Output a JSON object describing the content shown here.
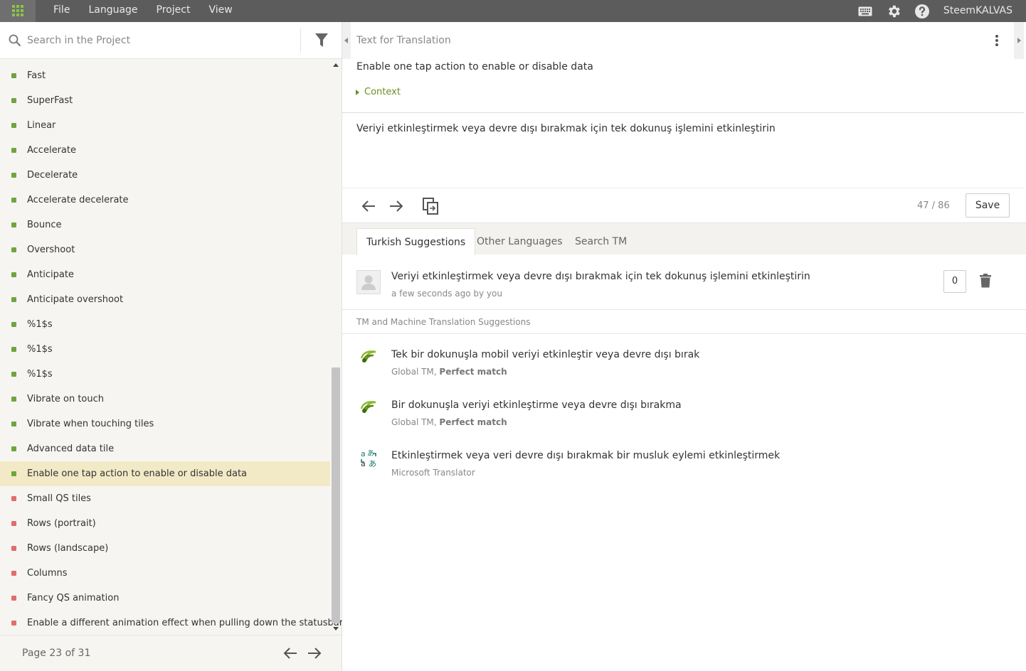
{
  "topbar": {
    "menu": [
      "File",
      "Language",
      "Project",
      "View"
    ],
    "icons": [
      "keyboard-icon",
      "gear-icon",
      "help-icon"
    ],
    "user": "SteemKALVAS"
  },
  "search": {
    "placeholder": "Search in the Project"
  },
  "strings": [
    {
      "label": "Fast",
      "status": "translated"
    },
    {
      "label": "SuperFast",
      "status": "translated"
    },
    {
      "label": "Linear",
      "status": "translated"
    },
    {
      "label": "Accelerate",
      "status": "translated"
    },
    {
      "label": "Decelerate",
      "status": "translated"
    },
    {
      "label": "Accelerate decelerate",
      "status": "translated"
    },
    {
      "label": "Bounce",
      "status": "translated"
    },
    {
      "label": "Overshoot",
      "status": "translated"
    },
    {
      "label": "Anticipate",
      "status": "translated"
    },
    {
      "label": "Anticipate overshoot",
      "status": "translated"
    },
    {
      "label": "%1$s",
      "status": "translated"
    },
    {
      "label": "%1$s",
      "status": "translated"
    },
    {
      "label": "%1$s",
      "status": "translated"
    },
    {
      "label": "Vibrate on touch",
      "status": "translated"
    },
    {
      "label": "Vibrate when touching tiles",
      "status": "translated"
    },
    {
      "label": "Advanced data tile",
      "status": "translated"
    },
    {
      "label": "Enable one tap action to enable or disable data",
      "status": "translated",
      "selected": true
    },
    {
      "label": "Small QS tiles",
      "status": "untranslated"
    },
    {
      "label": "Rows (portrait)",
      "status": "untranslated"
    },
    {
      "label": "Rows (landscape)",
      "status": "untranslated"
    },
    {
      "label": "Columns",
      "status": "untranslated"
    },
    {
      "label": "Fancy QS animation",
      "status": "untranslated"
    },
    {
      "label": "Enable a different animation effect when pulling down the statusbar",
      "status": "untranslated"
    }
  ],
  "pager": {
    "text": "Page 23 of 31"
  },
  "source": {
    "title": "Text for Translation",
    "text": "Enable one tap action to enable or disable data",
    "context_label": "Context"
  },
  "translation": {
    "text": "Veriyi etkinleştirmek veya devre dışı bırakmak için tek dokunuş işlemini etkinleştirin",
    "count": "47 / 86",
    "save_label": "Save"
  },
  "tabs": [
    "Turkish Suggestions",
    "Other Languages",
    "Search TM"
  ],
  "suggestion": {
    "text": "Veriyi etkinleştirmek veya devre dışı bırakmak için tek dokunuş işlemini etkinleştirin",
    "meta": "a few seconds ago by you",
    "votes": "0"
  },
  "tm": {
    "heading": "TM and Machine Translation Suggestions",
    "items": [
      {
        "text": "Tek bir dokunuşla mobil veriyi etkinleştir veya devre dışı bırak",
        "source": "Global TM,",
        "match": "Perfect match",
        "icon": "global-tm-icon"
      },
      {
        "text": "Bir dokunuşla veriyi etkinleştirme veya devre dışı bırakma",
        "source": "Global TM,",
        "match": "Perfect match",
        "icon": "global-tm-icon"
      },
      {
        "text": "Etkinleştirmek veya veri devre dışı bırakmak bir musluk eylemi etkinleştirmek",
        "source": "Microsoft Translator",
        "match": "",
        "icon": "microsoft-translator-icon"
      }
    ]
  },
  "colors": {
    "topbar": "#5c5c5c",
    "accent_green": "#71a43e",
    "untranslated_red": "#e26d6d",
    "selected_row": "#f2e9c6"
  }
}
